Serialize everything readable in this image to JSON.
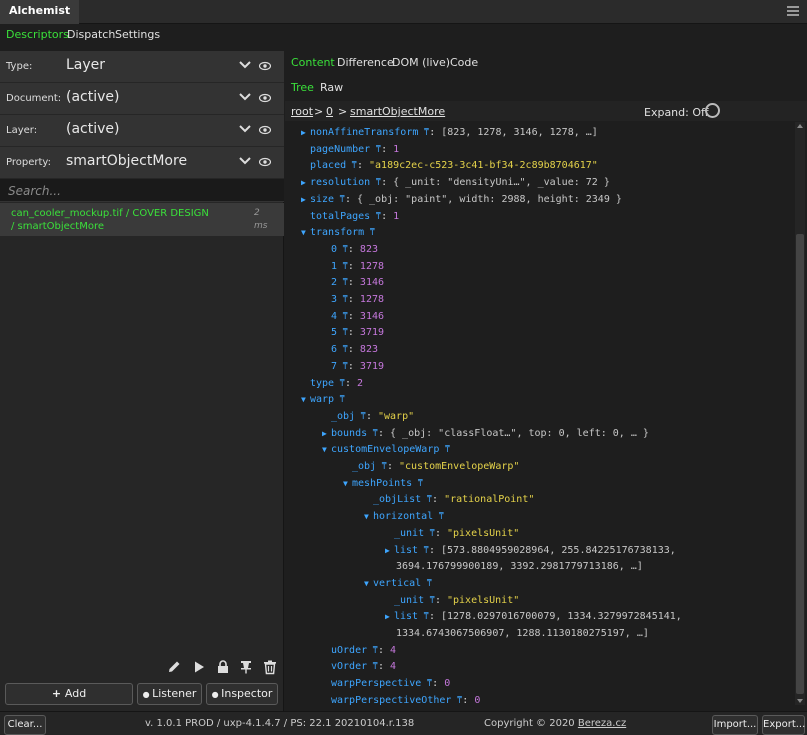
{
  "title": "Alchemist",
  "main_tabs": [
    "Descriptors",
    "Dispatch",
    "Settings"
  ],
  "fields": [
    {
      "label": "Type:",
      "value": "Layer"
    },
    {
      "label": "Document:",
      "value": "(active)"
    },
    {
      "label": "Layer:",
      "value": "(active)"
    },
    {
      "label": "Property:",
      "value": "smartObjectMore"
    }
  ],
  "search": {
    "placeholder": "Search..."
  },
  "list_item": {
    "text": "can_cooler_mockup.tif / COVER DESIGN / smartObjectMore",
    "time": "2 ms"
  },
  "buttons": {
    "add": "Add",
    "listener": "Listener",
    "inspector": "Inspector"
  },
  "content_tabs": [
    "Content",
    "Difference",
    "DOM (live)",
    "Code"
  ],
  "view_tabs": [
    "Tree",
    "Raw"
  ],
  "breadcrumb": {
    "root": "root",
    "sep": ">",
    "index": "0",
    "current": "smartObjectMore"
  },
  "expand_label": "Expand: Off",
  "tree": [
    {
      "indent": 0,
      "arrow": "right",
      "key": "nonAffineTransform",
      "type": "prev",
      "value": "[823, 1278, 3146, 1278, …]"
    },
    {
      "indent": 0,
      "arrow": "",
      "key": "pageNumber",
      "type": "num",
      "value": "1"
    },
    {
      "indent": 0,
      "arrow": "",
      "key": "placed",
      "type": "str",
      "value": "\"a189c2ec-c523-3c41-bf34-2c89b8704617\""
    },
    {
      "indent": 0,
      "arrow": "right",
      "key": "resolution",
      "type": "prev",
      "value": "{ _unit: \"densityUni…\", _value: 72 }"
    },
    {
      "indent": 0,
      "arrow": "right",
      "key": "size",
      "type": "prev",
      "value": "{ _obj: \"paint\", width: 2988, height: 2349 }"
    },
    {
      "indent": 0,
      "arrow": "",
      "key": "totalPages",
      "type": "num",
      "value": "1"
    },
    {
      "indent": 0,
      "arrow": "down",
      "key": "transform",
      "type": "none",
      "value": ""
    },
    {
      "indent": 2,
      "arrow": "",
      "key": "0",
      "type": "num",
      "value": "823"
    },
    {
      "indent": 2,
      "arrow": "",
      "key": "1",
      "type": "num",
      "value": "1278"
    },
    {
      "indent": 2,
      "arrow": "",
      "key": "2",
      "type": "num",
      "value": "3146"
    },
    {
      "indent": 2,
      "arrow": "",
      "key": "3",
      "type": "num",
      "value": "1278"
    },
    {
      "indent": 2,
      "arrow": "",
      "key": "4",
      "type": "num",
      "value": "3146"
    },
    {
      "indent": 2,
      "arrow": "",
      "key": "5",
      "type": "num",
      "value": "3719"
    },
    {
      "indent": 2,
      "arrow": "",
      "key": "6",
      "type": "num",
      "value": "823"
    },
    {
      "indent": 2,
      "arrow": "",
      "key": "7",
      "type": "num",
      "value": "3719"
    },
    {
      "indent": 0,
      "arrow": "",
      "key": "type",
      "type": "num",
      "value": "2"
    },
    {
      "indent": 0,
      "arrow": "down",
      "key": "warp",
      "type": "none",
      "value": ""
    },
    {
      "indent": 2,
      "arrow": "",
      "key": "_obj",
      "type": "str",
      "value": "\"warp\""
    },
    {
      "indent": 2,
      "arrow": "right",
      "key": "bounds",
      "type": "prev",
      "value": "{ _obj: \"classFloat…\", top: 0, left: 0, … }"
    },
    {
      "indent": 2,
      "arrow": "down",
      "key": "customEnvelopeWarp",
      "type": "none",
      "value": ""
    },
    {
      "indent": 4,
      "arrow": "",
      "key": "_obj",
      "type": "str",
      "value": "\"customEnvelopeWarp\""
    },
    {
      "indent": 4,
      "arrow": "down",
      "key": "meshPoints",
      "type": "none",
      "value": ""
    },
    {
      "indent": 6,
      "arrow": "",
      "key": "_objList",
      "type": "str",
      "value": "\"rationalPoint\""
    },
    {
      "indent": 6,
      "arrow": "down",
      "key": "horizontal",
      "type": "none",
      "value": ""
    },
    {
      "indent": 8,
      "arrow": "",
      "key": "_unit",
      "type": "str",
      "value": "\"pixelsUnit\""
    },
    {
      "indent": 8,
      "arrow": "right",
      "key": "list",
      "type": "prev",
      "value": "[573.8804959028964, 255.84225176738133,"
    },
    {
      "indent": 8,
      "arrow": "",
      "key": "",
      "type": "cont",
      "value": "3694.176799900189, 3392.2981779713186, …]"
    },
    {
      "indent": 6,
      "arrow": "down",
      "key": "vertical",
      "type": "none",
      "value": ""
    },
    {
      "indent": 8,
      "arrow": "",
      "key": "_unit",
      "type": "str",
      "value": "\"pixelsUnit\""
    },
    {
      "indent": 8,
      "arrow": "right",
      "key": "list",
      "type": "prev",
      "value": "[1278.0297016700079, 1334.3279972845141,"
    },
    {
      "indent": 8,
      "arrow": "",
      "key": "",
      "type": "cont",
      "value": "1334.6743067506907, 1288.1130180275197, …]"
    },
    {
      "indent": 2,
      "arrow": "",
      "key": "uOrder",
      "type": "num",
      "value": "4"
    },
    {
      "indent": 2,
      "arrow": "",
      "key": "vOrder",
      "type": "num",
      "value": "4"
    },
    {
      "indent": 2,
      "arrow": "",
      "key": "warpPerspective",
      "type": "num",
      "value": "0"
    },
    {
      "indent": 2,
      "arrow": "",
      "key": "warpPerspectiveOther",
      "type": "num",
      "value": "0"
    }
  ],
  "footer": {
    "clear": "Clear...",
    "version": "v. 1.0.1 PROD / uxp-4.1.4.7 / PS: 22.1 20210104.r.138",
    "copyright_prefix": "Copyright © 2020",
    "copyright_link": "Bereza.cz",
    "import": "Import...",
    "export": "Export..."
  },
  "colors": {
    "accent": "#3ae03a",
    "key": "#3ea6ff",
    "number": "#c678dd",
    "string": "#e5d34a"
  }
}
